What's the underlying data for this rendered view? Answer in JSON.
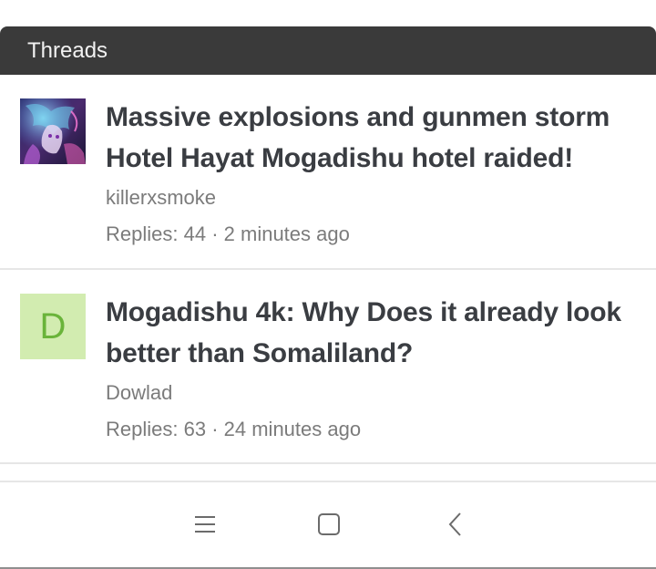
{
  "header": {
    "title": "Threads"
  },
  "threads": [
    {
      "title": "Massive explosions and gunmen storm Hotel Hayat Mogadishu hotel raided!",
      "author": "killerxsmoke",
      "replies_label": "Replies: 44",
      "separator": " · ",
      "time": "2 minutes ago",
      "avatar_type": "image"
    },
    {
      "title": "Mogadishu 4k: Why Does it already look better than Somaliland?",
      "author": "Dowlad",
      "replies_label": "Replies: 63",
      "separator": " · ",
      "time": "24 minutes ago",
      "avatar_type": "letter",
      "avatar_letter": "D",
      "avatar_bg": "#d2ecb0",
      "avatar_fg": "#6ab43a"
    }
  ],
  "nav": {
    "icons": [
      "menu-icon",
      "home-icon",
      "back-icon"
    ]
  },
  "colors": {
    "header_bg": "#3a3a3a",
    "title_text": "#3a3d42",
    "meta_text": "#7b7b7b"
  }
}
